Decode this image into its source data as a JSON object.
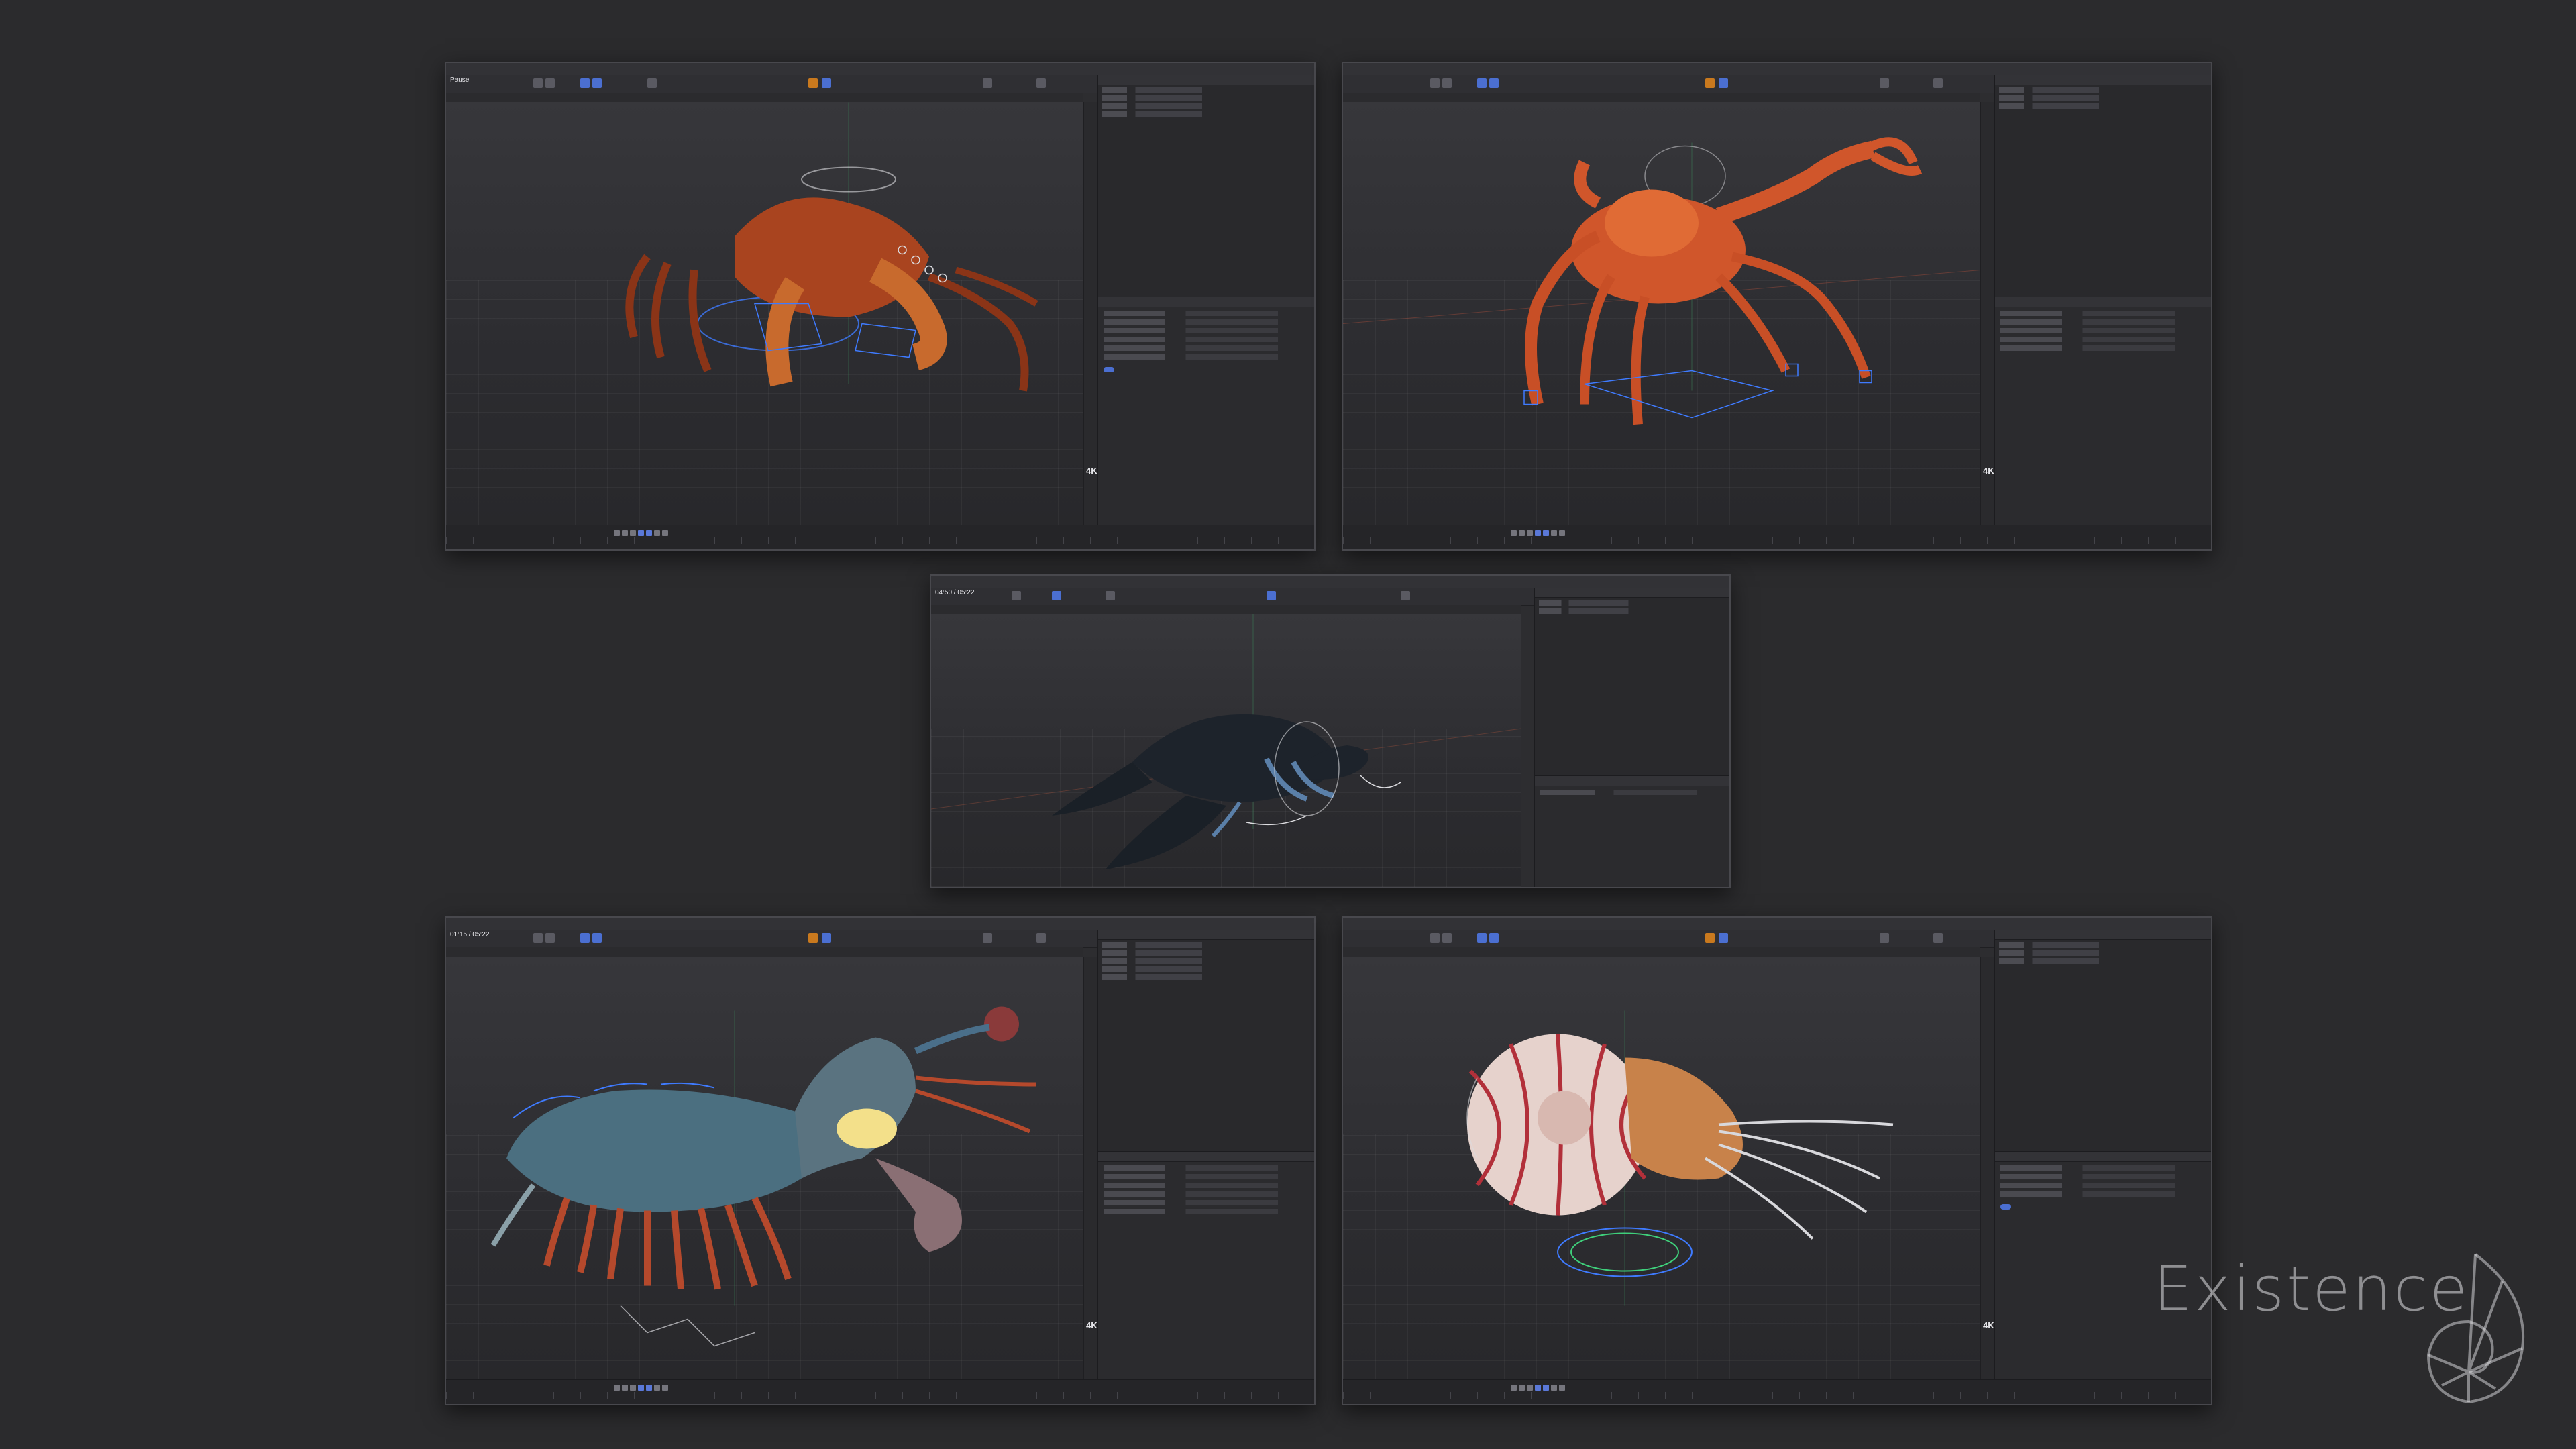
{
  "screens": [
    {
      "id": "coconut-crab",
      "time_label": "Pause",
      "tag": "4K"
    },
    {
      "id": "crab",
      "time_label": "",
      "tag": "4K"
    },
    {
      "id": "leatherback-turtle",
      "time_label": "04:50 / 05:22",
      "tag": ""
    },
    {
      "id": "anomalocarid",
      "time_label": "01:15 / 05:22",
      "tag": "4K"
    },
    {
      "id": "nautilus",
      "time_label": "",
      "tag": "4K"
    }
  ],
  "brand": {
    "name": "Existence"
  },
  "colors": {
    "background": "#2b2b2d",
    "accent_blue": "#4b6fd1",
    "rig_blue": "#3f7bff",
    "crab_orange": "#c5542a",
    "turtle_dark": "#1d232b",
    "nautilus_stripe": "#b2303a"
  }
}
